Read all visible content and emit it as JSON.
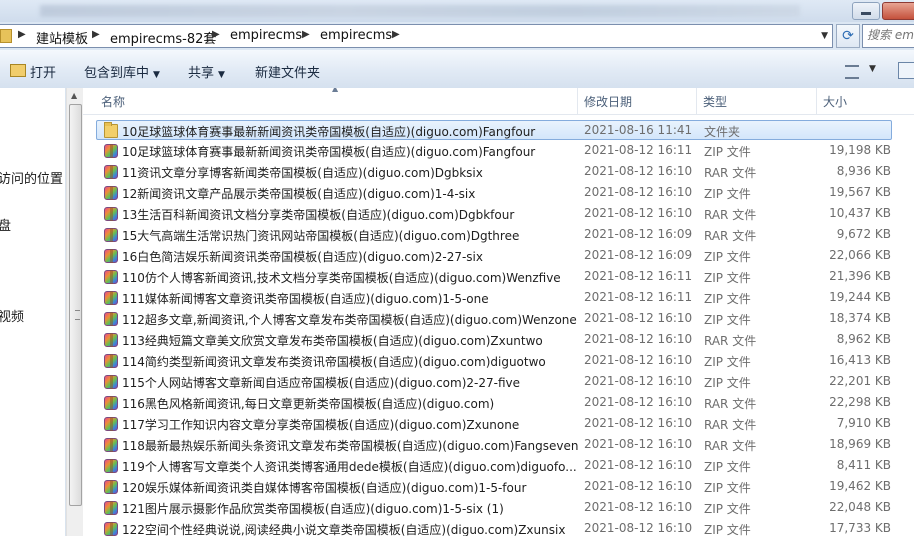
{
  "address": {
    "crumbs": [
      "建站模板",
      "empirecms-82套",
      "empirecms",
      "empirecms"
    ],
    "search_placeholder": "搜索 em"
  },
  "toolbar": {
    "open_label": "打开",
    "include_label": "包含到库中",
    "share_label": "共享",
    "new_folder_label": "新建文件夹"
  },
  "nav": {
    "items": [
      "访问的位置",
      "盘",
      "视频"
    ]
  },
  "columns": {
    "name": "名称",
    "date": "修改日期",
    "type": "类型",
    "size": "大小"
  },
  "files": [
    {
      "name": "10足球篮球体育赛事最新新闻资讯类帝国模板(自适应)(diguo.com)Fangfour",
      "date": "2021-08-16 11:41",
      "type": "文件夹",
      "size": "",
      "icon": "folder-icon",
      "selected": true
    },
    {
      "name": "10足球篮球体育赛事最新新闻资讯类帝国模板(自适应)(diguo.com)Fangfour",
      "date": "2021-08-12 16:11",
      "type": "ZIP 文件",
      "size": "19,198 KB",
      "icon": "archive-icon"
    },
    {
      "name": "11资讯文章分享博客新闻类帝国模板(自适应)(diguo.com)Dgbksix",
      "date": "2021-08-12 16:10",
      "type": "RAR 文件",
      "size": "8,936 KB",
      "icon": "archive-icon"
    },
    {
      "name": "12新闻资讯文章产品展示类帝国模板(自适应)(diguo.com)1-4-six",
      "date": "2021-08-12 16:10",
      "type": "ZIP 文件",
      "size": "19,567 KB",
      "icon": "archive-icon"
    },
    {
      "name": "13生活百科新闻资讯文档分享类帝国模板(自适应)(diguo.com)Dgbkfour",
      "date": "2021-08-12 16:10",
      "type": "RAR 文件",
      "size": "10,437 KB",
      "icon": "archive-icon"
    },
    {
      "name": "15大气高端生活常识热门资讯网站帝国模板(自适应)(diguo.com)Dgthree",
      "date": "2021-08-12 16:09",
      "type": "RAR 文件",
      "size": "9,672 KB",
      "icon": "archive-icon"
    },
    {
      "name": "16白色简洁娱乐新闻资讯类帝国模板(自适应)(diguo.com)2-27-six",
      "date": "2021-08-12 16:09",
      "type": "ZIP 文件",
      "size": "22,066 KB",
      "icon": "archive-icon"
    },
    {
      "name": "110仿个人博客新闻资讯,技术文档分享类帝国模板(自适应)(diguo.com)Wenzfive",
      "date": "2021-08-12 16:11",
      "type": "ZIP 文件",
      "size": "21,396 KB",
      "icon": "archive-icon"
    },
    {
      "name": "111媒体新闻博客文章资讯类帝国模板(自适应)(diguo.com)1-5-one",
      "date": "2021-08-12 16:11",
      "type": "ZIP 文件",
      "size": "19,244 KB",
      "icon": "archive-icon"
    },
    {
      "name": "112超多文章,新闻资讯,个人博客文章发布类帝国模板(自适应)(diguo.com)Wenzone",
      "date": "2021-08-12 16:10",
      "type": "ZIP 文件",
      "size": "18,374 KB",
      "icon": "archive-icon"
    },
    {
      "name": "113经典短篇文章美文欣赏文章发布类帝国模板(自适应)(diguo.com)Zxuntwo",
      "date": "2021-08-12 16:10",
      "type": "RAR 文件",
      "size": "8,962 KB",
      "icon": "archive-icon"
    },
    {
      "name": "114简约类型新闻资讯文章发布类资讯帝国模板(自适应)(diguo.com)diguotwo",
      "date": "2021-08-12 16:10",
      "type": "ZIP 文件",
      "size": "16,413 KB",
      "icon": "archive-icon"
    },
    {
      "name": "115个人网站博客文章新闻自适应帝国模板(自适应)(diguo.com)2-27-five",
      "date": "2021-08-12 16:10",
      "type": "ZIP 文件",
      "size": "22,201 KB",
      "icon": "archive-icon"
    },
    {
      "name": "116黑色风格新闻资讯,每日文章更新类帝国模板(自适应)(diguo.com)",
      "date": "2021-08-12 16:10",
      "type": "RAR 文件",
      "size": "22,298 KB",
      "icon": "archive-icon"
    },
    {
      "name": "117学习工作知识内容文章分享类帝国模板(自适应)(diguo.com)Zxunone",
      "date": "2021-08-12 16:10",
      "type": "RAR 文件",
      "size": "7,910 KB",
      "icon": "archive-icon"
    },
    {
      "name": "118最新最热娱乐新闻头条资讯文章发布类帝国模板(自适应)(diguo.com)Fangseven",
      "date": "2021-08-12 16:10",
      "type": "RAR 文件",
      "size": "18,969 KB",
      "icon": "archive-icon"
    },
    {
      "name": "119个人博客写文章类个人资讯类博客通用dede模板(自适应)(diguo.com)diguofo...",
      "date": "2021-08-12 16:10",
      "type": "ZIP 文件",
      "size": "8,411 KB",
      "icon": "archive-icon"
    },
    {
      "name": "120娱乐媒体新闻资讯类自媒体博客帝国模板(自适应)(diguo.com)1-5-four",
      "date": "2021-08-12 16:10",
      "type": "ZIP 文件",
      "size": "19,462 KB",
      "icon": "archive-icon"
    },
    {
      "name": "121图片展示摄影作品欣赏类帝国模板(自适应)(diguo.com)1-5-six (1)",
      "date": "2021-08-12 16:10",
      "type": "ZIP 文件",
      "size": "22,048 KB",
      "icon": "archive-icon"
    },
    {
      "name": "122空间个性经典说说,阅读经典小说文章类帝国模板(自适应)(diguo.com)Zxunsix",
      "date": "2021-08-12 16:10",
      "type": "ZIP 文件",
      "size": "17,733 KB",
      "icon": "archive-icon"
    }
  ]
}
